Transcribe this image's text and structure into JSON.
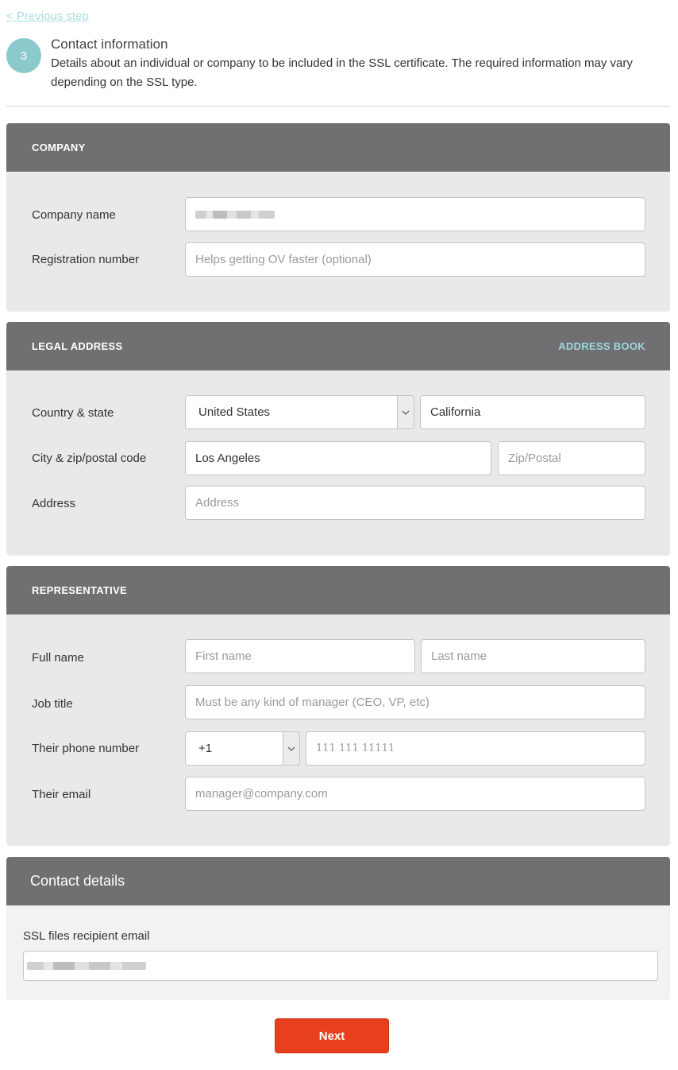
{
  "nav": {
    "previous_label": "< Previous step"
  },
  "step": {
    "number": "3",
    "title": "Contact information",
    "description": "Details about an individual or company to be included in the SSL certificate. The required information may vary depending on the SSL type."
  },
  "company": {
    "header": "COMPANY",
    "name_label": "Company name",
    "name_value_redacted": true,
    "reg_label": "Registration number",
    "reg_placeholder": "Helps getting OV faster (optional)"
  },
  "legal": {
    "header": "LEGAL ADDRESS",
    "address_book_label": "ADDRESS BOOK",
    "country_label": "Country & state",
    "country_value": "United States",
    "state_value": "California",
    "city_label": "City & zip/postal code",
    "city_value": "Los Angeles",
    "zip_placeholder": "Zip/Postal",
    "address_label": "Address",
    "address_placeholder": "Address"
  },
  "rep": {
    "header": "REPRESENTATIVE",
    "fullname_label": "Full name",
    "first_placeholder": "First name",
    "last_placeholder": "Last name",
    "job_label": "Job title",
    "job_placeholder": "Must be any kind of manager (CEO, VP, etc)",
    "phone_label": "Their phone number",
    "phone_code": "+1",
    "phone_placeholder": "111 111 11111",
    "email_label": "Their email",
    "email_placeholder": "manager@company.com"
  },
  "contact": {
    "header": "Contact details",
    "email_label": "SSL files recipient email",
    "email_value_redacted": true
  },
  "actions": {
    "next_label": "Next"
  },
  "colors": {
    "accent_teal": "#8cc9cd",
    "panel_header": "#707072",
    "panel_body": "#e9e9ea",
    "primary_button": "#e8401f"
  },
  "icons": {
    "select_arrow": "chevron-down-icon"
  }
}
